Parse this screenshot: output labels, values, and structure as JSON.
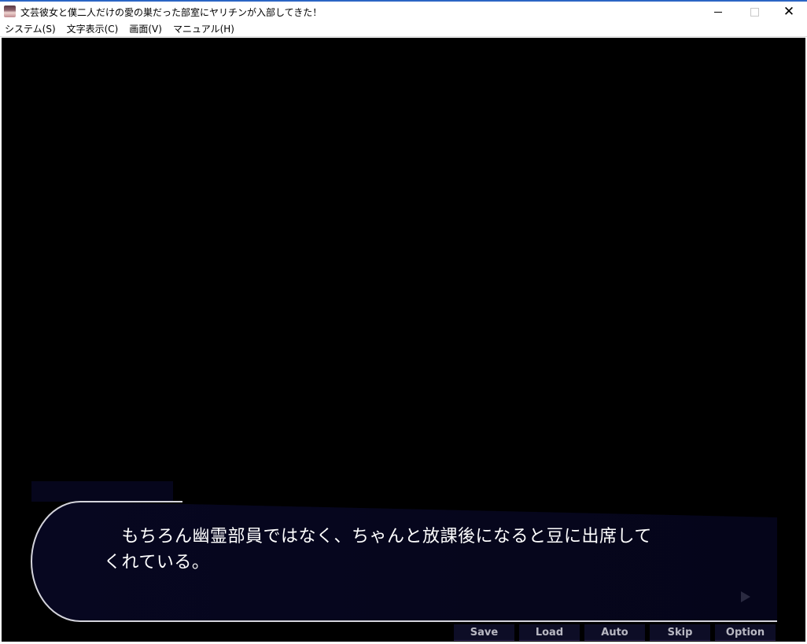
{
  "window": {
    "title": "文芸彼女と僕二人だけの愛の巣だった部室にヤリチンが入部してきた！",
    "icon": "app-icon",
    "controls": {
      "minimize": "minimize-icon",
      "maximize": "maximize-icon",
      "close": "✕"
    }
  },
  "menubar": {
    "items": [
      {
        "label": "システム(S)"
      },
      {
        "label": "文字表示(C)"
      },
      {
        "label": "画面(V)"
      },
      {
        "label": "マニュアル(H)"
      }
    ]
  },
  "game": {
    "speaker_name": "",
    "dialogue": "　もちろん幽霊部員ではなく、ちゃんと放課後になると豆に出席して\nくれている。",
    "buttons": [
      {
        "label": "Save"
      },
      {
        "label": "Load"
      },
      {
        "label": "Auto"
      },
      {
        "label": "Skip"
      },
      {
        "label": "Option"
      }
    ],
    "colors": {
      "background": "#000000",
      "textbox": "#06061c",
      "text": "#ffffff",
      "button_text": "#b8b8c2"
    }
  }
}
